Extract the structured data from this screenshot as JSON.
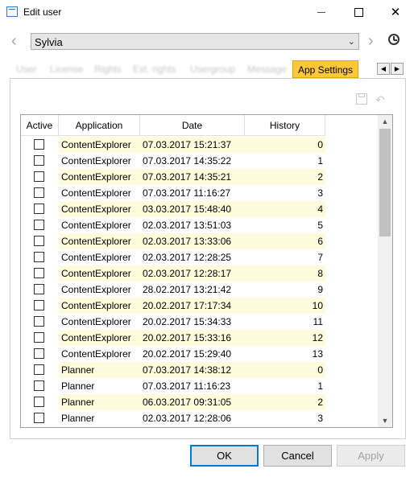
{
  "window": {
    "title": "Edit user"
  },
  "user_selector": {
    "value": "Sylvia"
  },
  "tabs": [
    {
      "label": "User"
    },
    {
      "label": "License"
    },
    {
      "label": "Rights"
    },
    {
      "label": "Ext. rights"
    },
    {
      "label": "Usergroup"
    },
    {
      "label": "Message"
    },
    {
      "label": "App Settings",
      "active": true
    }
  ],
  "table": {
    "columns": [
      "Active",
      "Application",
      "Date",
      "History"
    ],
    "rows": [
      {
        "application": "ContentExplorer",
        "date": "07.03.2017 15:21:37",
        "history": "0",
        "active": false
      },
      {
        "application": "ContentExplorer",
        "date": "07.03.2017 14:35:22",
        "history": "1",
        "active": false
      },
      {
        "application": "ContentExplorer",
        "date": "07.03.2017 14:35:21",
        "history": "2",
        "active": false
      },
      {
        "application": "ContentExplorer",
        "date": "07.03.2017 11:16:27",
        "history": "3",
        "active": false
      },
      {
        "application": "ContentExplorer",
        "date": "03.03.2017 15:48:40",
        "history": "4",
        "active": false
      },
      {
        "application": "ContentExplorer",
        "date": "02.03.2017 13:51:03",
        "history": "5",
        "active": false
      },
      {
        "application": "ContentExplorer",
        "date": "02.03.2017 13:33:06",
        "history": "6",
        "active": false
      },
      {
        "application": "ContentExplorer",
        "date": "02.03.2017 12:28:25",
        "history": "7",
        "active": false
      },
      {
        "application": "ContentExplorer",
        "date": "02.03.2017 12:28:17",
        "history": "8",
        "active": false
      },
      {
        "application": "ContentExplorer",
        "date": "28.02.2017 13:21:42",
        "history": "9",
        "active": false
      },
      {
        "application": "ContentExplorer",
        "date": "20.02.2017 17:17:34",
        "history": "10",
        "active": false
      },
      {
        "application": "ContentExplorer",
        "date": "20.02.2017 15:34:33",
        "history": "11",
        "active": false
      },
      {
        "application": "ContentExplorer",
        "date": "20.02.2017 15:33:16",
        "history": "12",
        "active": false
      },
      {
        "application": "ContentExplorer",
        "date": "20.02.2017 15:29:40",
        "history": "13",
        "active": false
      },
      {
        "application": "Planner",
        "date": "07.03.2017 14:38:12",
        "history": "0",
        "active": false
      },
      {
        "application": "Planner",
        "date": "07.03.2017 11:16:23",
        "history": "1",
        "active": false
      },
      {
        "application": "Planner",
        "date": "06.03.2017 09:31:05",
        "history": "2",
        "active": false
      },
      {
        "application": "Planner",
        "date": "02.03.2017 12:28:06",
        "history": "3",
        "active": false
      }
    ]
  },
  "buttons": {
    "ok": "OK",
    "cancel": "Cancel",
    "apply": "Apply"
  },
  "icons": {
    "app": "app-window-icon",
    "history": "history-clock-icon",
    "save": "save-icon",
    "undo": "undo-icon"
  },
  "colors": {
    "accent": "#0078d7",
    "active_tab": "#ffc83a",
    "row_highlight": "#fffbdc"
  }
}
